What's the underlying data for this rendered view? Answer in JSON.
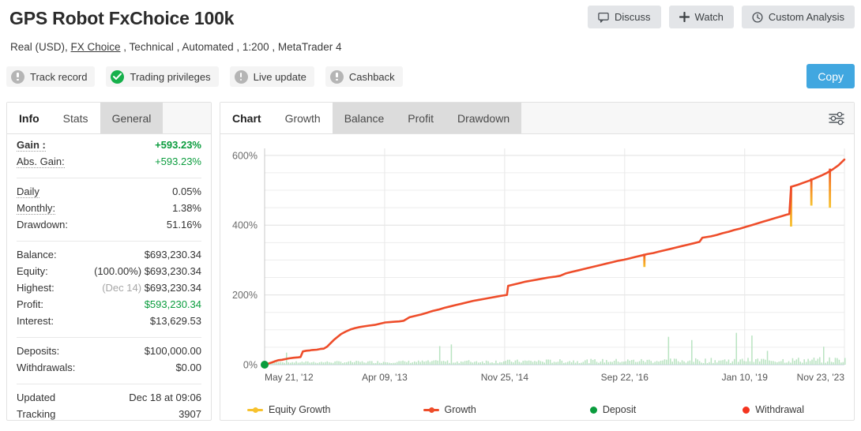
{
  "header": {
    "title": "GPS Robot FxChoice 100k",
    "subtitle_pre": "Real (USD), ",
    "subtitle_link": "FX Choice",
    "subtitle_post": " , Technical , Automated , 1:200 , MetaTrader 4",
    "badges": [
      {
        "label": "Track record",
        "icon": "exclamation-icon",
        "state": "gray"
      },
      {
        "label": "Trading privileges",
        "icon": "check-icon",
        "state": "green"
      },
      {
        "label": "Live update",
        "icon": "exclamation-icon",
        "state": "gray"
      },
      {
        "label": "Cashback",
        "icon": "exclamation-icon",
        "state": "gray"
      }
    ],
    "actions": [
      {
        "label": "Discuss",
        "icon": "comment-icon"
      },
      {
        "label": "Watch",
        "icon": "plus-icon"
      },
      {
        "label": "Custom Analysis",
        "icon": "clock-icon"
      }
    ],
    "copy_label": "Copy"
  },
  "sidebar": {
    "tabs": [
      {
        "label": "Info",
        "state": "active"
      },
      {
        "label": "Stats",
        "state": "white"
      },
      {
        "label": "General",
        "state": "shade"
      }
    ],
    "groups": [
      {
        "rows": [
          {
            "key": "Gain :",
            "value": "+593.23%",
            "dotted": true,
            "bold": true,
            "value_color": "#0a9c3d"
          },
          {
            "key": "Abs. Gain:",
            "value": "+593.23%",
            "dotted": true,
            "value_color": "#0a9c3d"
          }
        ]
      },
      {
        "rows": [
          {
            "key": "Daily",
            "value": "0.05%",
            "dotted": true
          },
          {
            "key": "Monthly:",
            "value": "1.38%",
            "dotted": true
          },
          {
            "key": "Drawdown:",
            "value": "51.16%"
          }
        ]
      },
      {
        "rows": [
          {
            "key": "Balance:",
            "value": "$693,230.34"
          },
          {
            "key": "Equity:",
            "value": "$693,230.34",
            "prefix": "(100.00%)"
          },
          {
            "key": "Highest:",
            "value": "$693,230.34",
            "prefix": "(Dec 14)",
            "prefix_muted": true
          },
          {
            "key": "Profit:",
            "value": "$593,230.34",
            "value_color": "#0a9c3d"
          },
          {
            "key": "Interest:",
            "value": "$13,629.53"
          }
        ]
      },
      {
        "rows": [
          {
            "key": "Deposits:",
            "value": "$100,000.00"
          },
          {
            "key": "Withdrawals:",
            "value": "$0.00"
          }
        ]
      },
      {
        "rows": [
          {
            "key": "Updated",
            "value": "Dec 18 at 09:06"
          },
          {
            "key": "Tracking",
            "value": "3907"
          }
        ]
      }
    ]
  },
  "chart_panel": {
    "tabs": [
      {
        "label": "Chart",
        "state": "active"
      },
      {
        "label": "Growth",
        "state": "white"
      },
      {
        "label": "Balance",
        "state": "shade"
      },
      {
        "label": "Profit",
        "state": "shade"
      },
      {
        "label": "Drawdown",
        "state": "shade"
      }
    ],
    "settings_icon": "sliders-icon"
  },
  "chart_data": {
    "type": "line",
    "title": "",
    "xlabel": "",
    "ylabel": "",
    "ylim": [
      0,
      620
    ],
    "yticks": [
      0,
      200,
      400,
      600
    ],
    "ytick_labels": [
      "0%",
      "200%",
      "400%",
      "600%"
    ],
    "minor_gridline_step": 50,
    "grid": true,
    "legend_position": "bottom",
    "xticks": [
      "May 21, '12",
      "Apr 09, '13",
      "Nov 25, '14",
      "Sep 22, '16",
      "Jan 10, '19",
      "Nov 23, '23"
    ],
    "xtick_positions": [
      0,
      0.207,
      0.414,
      0.621,
      0.828,
      1.0
    ],
    "colors": {
      "growth": "#ee4d2a",
      "equity_growth": "#f7c22e",
      "deposit": "#0a9c3d",
      "withdrawal": "#f4341f",
      "volume_bar": "#b8e3c0",
      "grid": "#ededed",
      "axis": "#c8c8c8"
    },
    "series": [
      {
        "name": "Equity Growth",
        "type": "line",
        "color": "#f7c22e",
        "legend_marker": "line-dot"
      },
      {
        "name": "Growth",
        "type": "line",
        "color": "#ee4d2a",
        "legend_marker": "line-dot",
        "points": [
          [
            0.0,
            0
          ],
          [
            0.006,
            3
          ],
          [
            0.012,
            6
          ],
          [
            0.018,
            10
          ],
          [
            0.024,
            13
          ],
          [
            0.03,
            14
          ],
          [
            0.036,
            16
          ],
          [
            0.042,
            18
          ],
          [
            0.05,
            20
          ],
          [
            0.058,
            21
          ],
          [
            0.062,
            22
          ],
          [
            0.066,
            38
          ],
          [
            0.072,
            40
          ],
          [
            0.078,
            41
          ],
          [
            0.082,
            42
          ],
          [
            0.09,
            43
          ],
          [
            0.096,
            45
          ],
          [
            0.102,
            46
          ],
          [
            0.108,
            52
          ],
          [
            0.114,
            62
          ],
          [
            0.12,
            72
          ],
          [
            0.126,
            80
          ],
          [
            0.132,
            88
          ],
          [
            0.14,
            95
          ],
          [
            0.148,
            101
          ],
          [
            0.156,
            105
          ],
          [
            0.164,
            108
          ],
          [
            0.172,
            110
          ],
          [
            0.18,
            112
          ],
          [
            0.19,
            114
          ],
          [
            0.2,
            118
          ],
          [
            0.208,
            121
          ],
          [
            0.216,
            122
          ],
          [
            0.224,
            123
          ],
          [
            0.232,
            124
          ],
          [
            0.24,
            126
          ],
          [
            0.25,
            136
          ],
          [
            0.26,
            140
          ],
          [
            0.27,
            144
          ],
          [
            0.28,
            149
          ],
          [
            0.29,
            154
          ],
          [
            0.3,
            158
          ],
          [
            0.31,
            163
          ],
          [
            0.32,
            167
          ],
          [
            0.33,
            171
          ],
          [
            0.34,
            175
          ],
          [
            0.35,
            179
          ],
          [
            0.36,
            183
          ],
          [
            0.37,
            186
          ],
          [
            0.38,
            189
          ],
          [
            0.39,
            192
          ],
          [
            0.4,
            195
          ],
          [
            0.41,
            198
          ],
          [
            0.418,
            200
          ],
          [
            0.42,
            226
          ],
          [
            0.43,
            230
          ],
          [
            0.44,
            234
          ],
          [
            0.45,
            238
          ],
          [
            0.46,
            241
          ],
          [
            0.47,
            244
          ],
          [
            0.48,
            247
          ],
          [
            0.49,
            250
          ],
          [
            0.5,
            252
          ],
          [
            0.51,
            255
          ],
          [
            0.52,
            262
          ],
          [
            0.53,
            266
          ],
          [
            0.54,
            270
          ],
          [
            0.55,
            274
          ],
          [
            0.56,
            278
          ],
          [
            0.57,
            282
          ],
          [
            0.58,
            286
          ],
          [
            0.59,
            290
          ],
          [
            0.6,
            294
          ],
          [
            0.61,
            298
          ],
          [
            0.62,
            301
          ],
          [
            0.63,
            305
          ],
          [
            0.64,
            309
          ],
          [
            0.65,
            313
          ],
          [
            0.66,
            317
          ],
          [
            0.67,
            320
          ],
          [
            0.68,
            324
          ],
          [
            0.69,
            328
          ],
          [
            0.7,
            332
          ],
          [
            0.71,
            336
          ],
          [
            0.72,
            340
          ],
          [
            0.73,
            344
          ],
          [
            0.74,
            348
          ],
          [
            0.75,
            352
          ],
          [
            0.755,
            364
          ],
          [
            0.77,
            368
          ],
          [
            0.78,
            372
          ],
          [
            0.79,
            377
          ],
          [
            0.8,
            381
          ],
          [
            0.81,
            386
          ],
          [
            0.82,
            390
          ],
          [
            0.83,
            395
          ],
          [
            0.84,
            400
          ],
          [
            0.85,
            405
          ],
          [
            0.86,
            410
          ],
          [
            0.87,
            415
          ],
          [
            0.88,
            420
          ],
          [
            0.89,
            425
          ],
          [
            0.9,
            430
          ],
          [
            0.905,
            432
          ],
          [
            0.908,
            510
          ],
          [
            0.92,
            516
          ],
          [
            0.93,
            522
          ],
          [
            0.94,
            528
          ],
          [
            0.95,
            535
          ],
          [
            0.96,
            542
          ],
          [
            0.97,
            550
          ],
          [
            0.98,
            560
          ],
          [
            0.99,
            572
          ],
          [
            1.0,
            588
          ]
        ]
      },
      {
        "name": "Deposit",
        "type": "marker",
        "color": "#0a9c3d",
        "legend_marker": "dot",
        "points": [
          [
            0.0,
            0
          ]
        ]
      },
      {
        "name": "Withdrawal",
        "type": "marker",
        "color": "#f4341f",
        "legend_marker": "dot",
        "points": []
      }
    ],
    "drawdown_spikes": [
      {
        "x": 0.655,
        "top": 318,
        "bottom": 280
      },
      {
        "x": 0.908,
        "top": 512,
        "bottom": 396
      },
      {
        "x": 0.943,
        "top": 534,
        "bottom": 456
      },
      {
        "x": 0.975,
        "top": 562,
        "bottom": 450
      }
    ],
    "volume_bars_note": "light green vertical bars along baseline, denser and taller toward the right"
  }
}
